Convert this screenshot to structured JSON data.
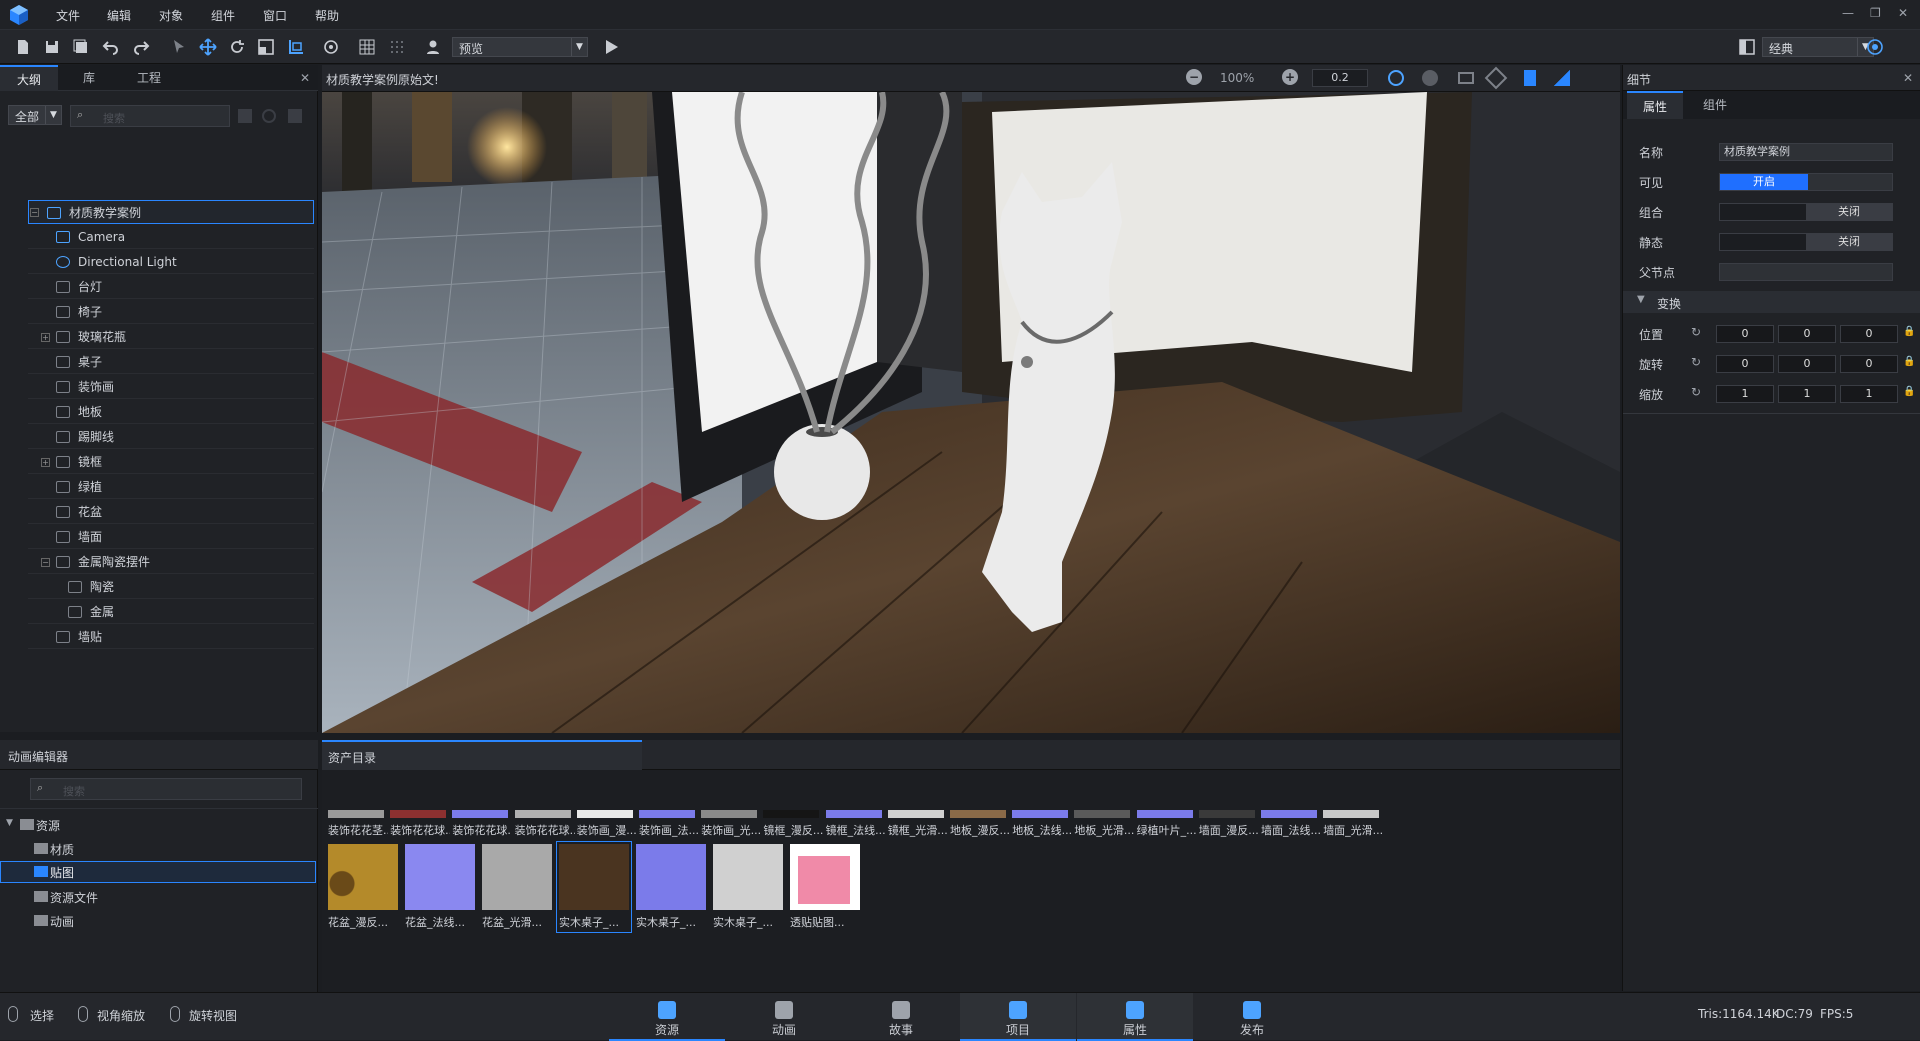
{
  "menu": {
    "items": [
      "文件",
      "编辑",
      "对象",
      "组件",
      "窗口",
      "帮助"
    ]
  },
  "toolbar": {
    "view_mode": "预览",
    "layout_mode": "经典"
  },
  "outline": {
    "tabs": [
      "大纲",
      "库",
      "工程"
    ],
    "filter": "全部",
    "search_placeholder": "搜索",
    "items": [
      {
        "label": "材质教学案例",
        "icon": "scene-icon"
      },
      {
        "label": "Camera",
        "icon": "camera-icon"
      },
      {
        "label": "Directional Light",
        "icon": "light-icon"
      },
      {
        "label": "台灯",
        "icon": "node-icon"
      },
      {
        "label": "椅子",
        "icon": "node-icon"
      },
      {
        "label": "玻璃花瓶",
        "icon": "node-icon"
      },
      {
        "label": "桌子",
        "icon": "node-icon"
      },
      {
        "label": "装饰画",
        "icon": "node-icon"
      },
      {
        "label": "地板",
        "icon": "node-icon"
      },
      {
        "label": "踢脚线",
        "icon": "node-icon"
      },
      {
        "label": "镜框",
        "icon": "node-icon"
      },
      {
        "label": "绿植",
        "icon": "node-icon"
      },
      {
        "label": "花盆",
        "icon": "node-icon"
      },
      {
        "label": "墙面",
        "icon": "node-icon"
      },
      {
        "label": "金属陶瓷摆件",
        "icon": "node-icon"
      },
      {
        "label": "陶瓷",
        "icon": "node-icon"
      },
      {
        "label": "金属",
        "icon": "node-icon"
      },
      {
        "label": "墙贴",
        "icon": "node-icon"
      }
    ]
  },
  "viewport": {
    "title": "材质教学案例原始文!",
    "zoom": "100%",
    "step": "0.2"
  },
  "details": {
    "title": "细节",
    "tabs": [
      "属性",
      "组件"
    ],
    "name_label": "名称",
    "name_value": "材质教学案例",
    "visible_label": "可见",
    "visible_value": "开启",
    "group_label": "组合",
    "group_value": "关闭",
    "static_label": "静态",
    "static_value": "关闭",
    "parent_label": "父节点",
    "transform_label": "变换",
    "position_label": "位置",
    "position": [
      "0",
      "0",
      "0"
    ],
    "rotation_label": "旋转",
    "rotation": [
      "0",
      "0",
      "0"
    ],
    "scale_label": "缩放",
    "scale": [
      "1",
      "1",
      "1"
    ]
  },
  "anim": {
    "title": "动画编辑器",
    "search_placeholder": "搜索",
    "tree": [
      "资源",
      "材质",
      "贴图",
      "资源文件",
      "动画"
    ]
  },
  "assets": {
    "title": "资产目录",
    "row1": [
      {
        "name": "装饰花花茎...",
        "color": "#9a9a9a"
      },
      {
        "name": "装饰花花球...",
        "color": "#8c3030"
      },
      {
        "name": "装饰花花球...",
        "color": "#7b7bea"
      },
      {
        "name": "装饰花花球...",
        "color": "#b0b0b0"
      },
      {
        "name": "装饰画_漫...",
        "color": "#e8e8e8"
      },
      {
        "name": "装饰画_法...",
        "color": "#7b7bea"
      },
      {
        "name": "装饰画_光...",
        "color": "#8a8a8a"
      },
      {
        "name": "镜框_漫反...",
        "color": "#151515"
      },
      {
        "name": "镜框_法线...",
        "color": "#7b7bea"
      },
      {
        "name": "镜框_光滑...",
        "color": "#d0d0d0"
      },
      {
        "name": "地板_漫反...",
        "color": "#8a6a48"
      },
      {
        "name": "地板_法线...",
        "color": "#7b7bea"
      },
      {
        "name": "地板_光滑...",
        "color": "#5a5a5a"
      },
      {
        "name": "绿植叶片_...",
        "color": "#7b7bea"
      },
      {
        "name": "墙面_漫反...",
        "color": "#3a3a3a"
      },
      {
        "name": "墙面_法线...",
        "color": "#7b7bea"
      },
      {
        "name": "墙面_光滑...",
        "color": "#c8c8c8"
      }
    ],
    "row2": [
      {
        "name": "花盆_漫反...",
        "color": "#b48a2a"
      },
      {
        "name": "花盆_法线...",
        "color": "#8a88f0"
      },
      {
        "name": "花盆_光滑...",
        "color": "#a9a9a9"
      },
      {
        "name": "实木桌子_...",
        "color": "#4a3420"
      },
      {
        "name": "实木桌子_...",
        "color": "#7b7bea"
      },
      {
        "name": "实木桌子_...",
        "color": "#d0d0d0"
      },
      {
        "name": "透贴贴图...",
        "color": "#f08aa8"
      }
    ]
  },
  "bottom_nav": [
    "资源",
    "动画",
    "故事",
    "项目",
    "属性",
    "发布"
  ],
  "status": {
    "hints": [
      "选择",
      "视角缩放",
      "旋转视图"
    ],
    "tris": "Tris:1164.14K",
    "dc": "DC:79",
    "fps": "FPS:5"
  },
  "colors": {
    "accent": "#2a86ff"
  }
}
